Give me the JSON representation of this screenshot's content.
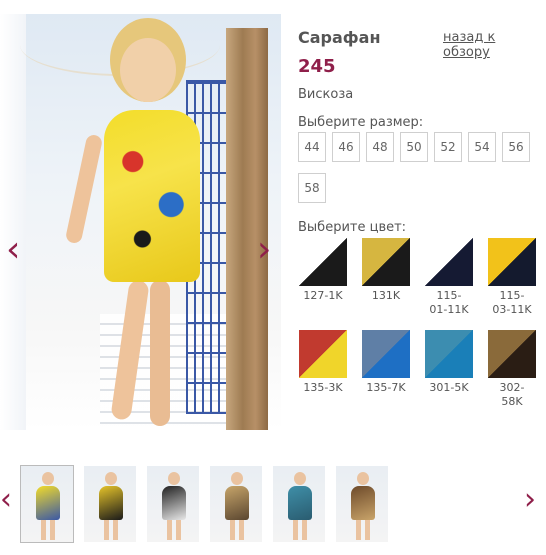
{
  "product": {
    "title": "Сарафан",
    "back_link": "назад к обзору",
    "price": "245",
    "fabric": "Вискоза"
  },
  "gallery": {
    "prev_arrow": "‹",
    "next_arrow": "›"
  },
  "size_label": "Выберите размер:",
  "sizes": [
    "44",
    "46",
    "48",
    "50",
    "52",
    "54",
    "56",
    "58"
  ],
  "color_label": "Выберите цвет:",
  "colors": [
    {
      "code_line1": "127-1K",
      "code_line2": "",
      "colors": [
        "#ffffff",
        "#1a1a1a"
      ]
    },
    {
      "code_line1": "131K",
      "code_line2": "",
      "colors": [
        "#d6b640",
        "#1a1a1a"
      ]
    },
    {
      "code_line1": "115-",
      "code_line2": "01-11K",
      "colors": [
        "#ffffff",
        "#151a33"
      ]
    },
    {
      "code_line1": "115-",
      "code_line2": "03-11K",
      "colors": [
        "#f2c21a",
        "#141a2e"
      ]
    },
    {
      "code_line1": "135-3K",
      "code_line2": "",
      "colors": [
        "#c13a2f",
        "#f0d52a"
      ]
    },
    {
      "code_line1": "135-7K",
      "code_line2": "",
      "colors": [
        "#5f7fa6",
        "#1e6fc4"
      ]
    },
    {
      "code_line1": "301-5K",
      "code_line2": "",
      "colors": [
        "#3c8db0",
        "#1a7fb8"
      ]
    },
    {
      "code_line1": "302-",
      "code_line2": "58K",
      "colors": [
        "#8a6a3a",
        "#2a1d14"
      ]
    }
  ],
  "thumbnails": [
    {
      "name": "thumb-yellow-print-dress",
      "colors": [
        "#f2dc2a",
        "#3a58a6"
      ],
      "active": true
    },
    {
      "name": "thumb-yellow-polka-dress",
      "colors": [
        "#e6c42a",
        "#1a1a1a"
      ],
      "active": false
    },
    {
      "name": "thumb-black-white-dress",
      "colors": [
        "#202020",
        "#e8e8e8"
      ],
      "active": false
    },
    {
      "name": "thumb-beige-print-dress",
      "colors": [
        "#c7a56a",
        "#5a4630"
      ],
      "active": false
    },
    {
      "name": "thumb-teal-print-dress",
      "colors": [
        "#3f8fa8",
        "#2a5c70"
      ],
      "active": false
    },
    {
      "name": "thumb-brown-print-dress",
      "colors": [
        "#6d4a2a",
        "#c9a46a"
      ],
      "active": false
    }
  ]
}
